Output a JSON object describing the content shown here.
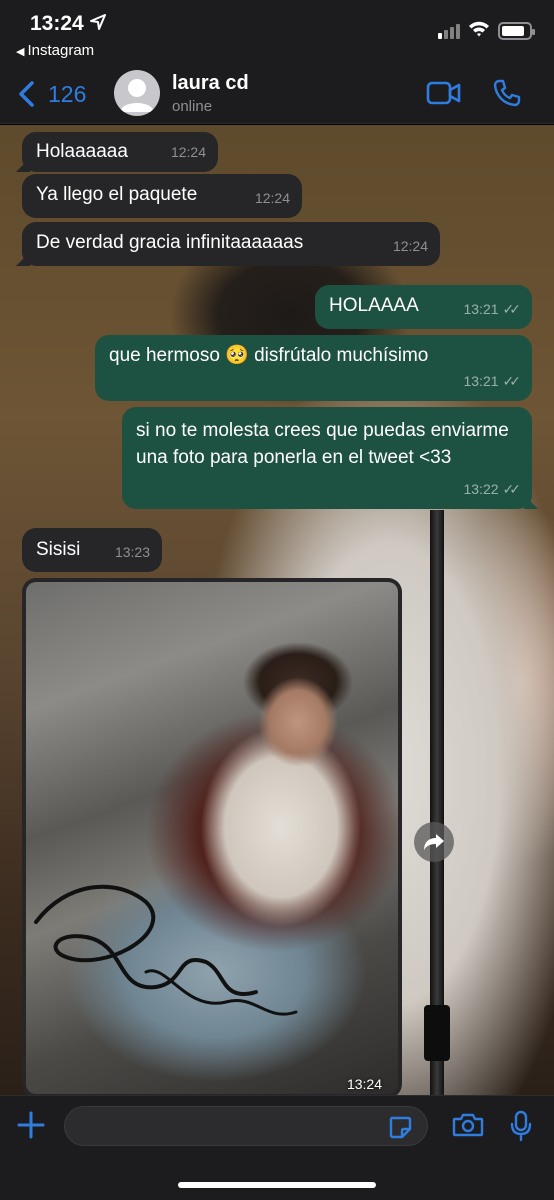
{
  "status_bar": {
    "time": "13:24",
    "back_app": "Instagram"
  },
  "header": {
    "unread_count": "126",
    "contact_name": "laura cd",
    "contact_status": "online"
  },
  "messages": [
    {
      "dir": "in",
      "text": "Holaaaaaa",
      "time": "12:24"
    },
    {
      "dir": "in",
      "text": "Ya llego el paquete",
      "time": "12:24"
    },
    {
      "dir": "in",
      "text": "De verdad gracia infinitaaaaaas",
      "time": "12:24"
    },
    {
      "dir": "out",
      "text": "HOLAAAA",
      "time": "13:21"
    },
    {
      "dir": "out",
      "text": "que hermoso 🥺 disfrútalo muchísimo",
      "time": "13:21"
    },
    {
      "dir": "out",
      "text": "si no te molesta crees que puedas enviarme una foto para ponerla en el tweet <33",
      "time": "13:22"
    },
    {
      "dir": "in",
      "text": "Sisisi",
      "time": "13:23"
    }
  ],
  "photo_message": {
    "time": "13:24"
  },
  "input": {
    "placeholder": ""
  },
  "colors": {
    "accent": "#2f7de1",
    "incoming_bubble": "#262628",
    "outgoing_bubble": "#1d5141"
  }
}
